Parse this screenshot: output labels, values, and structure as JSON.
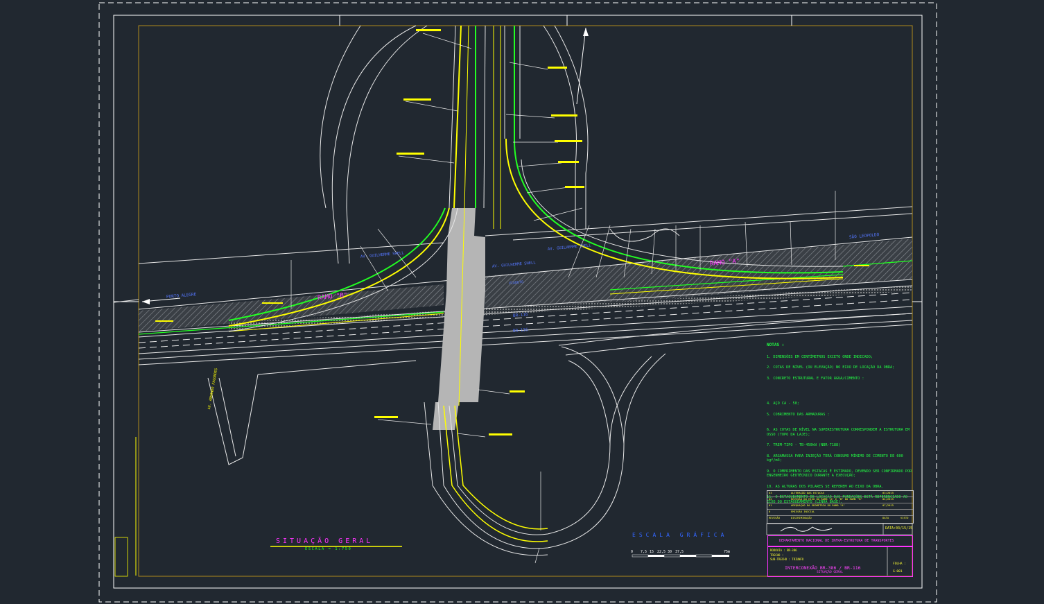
{
  "drawing": {
    "title_main": "SITUAÇÃO  GERAL",
    "title_scale": "ESCALA = 1:750",
    "graphic_scale_title": "ESCALA GRÁFICA",
    "graphic_scale_ticks": [
      "0",
      "7,5",
      "15",
      "22,5",
      "30",
      "37,5",
      "75m"
    ]
  },
  "labels": {
    "ramo_a": "RAMO \"A\"",
    "ramo_b": "RAMO \"B\"",
    "av_guilherme_1": "AV. GUILHERME SHELL",
    "av_guilherme_2": "AV. GUILHERME SHELL",
    "br116_1": "BR-116",
    "br116_2": "BR-116",
    "viaduto": "VIADUTO",
    "to_left": "PORTO ALEGRE",
    "to_right": "SÃO LEOPOLDO",
    "av_armando": "AV. ARMANDO FAGUNDES"
  },
  "notes": {
    "heading": "NOTAS :",
    "items": [
      "1.  DIMENSÕES EM CENTÍMETROS EXCETO ONDE INDICADO;",
      "2.  COTAS DE NÍVEL (OU ELEVAÇÃO) NO EIXO DE LOCAÇÃO DA OBRA;",
      "3.  CONCRETO ESTRUTURAL E FATOR ÁGUA/CIMENTO :",
      "4.  AÇO CA - 50;",
      "5.  COBRIMENTO DAS ARMADURAS :",
      "6.  AS COTAS DE NÍVEL NA SUPERESTRUTURA CORRESPONDEM A ESTRUTURA EM OSSO (TOPO DA LAJE);",
      "7.  TREM-TIPO - TB-450kN (NBR-7188)",
      "8.  ARGAMASSA PARA INJEÇÃO TERÁ CONSUMO MÍNIMO DE CIMENTO DE 600 kgf/m3;",
      "9.  O COMPRIMENTO DAS ESTACAS É ESTIMADO, DEVENDO SER CONFIRMADO POR ENGENHEIRO GEOTÉCNICO DURANTE A EXECUÇÃO;",
      "10. AS ALTURAS DOS PILARES SE REFEREM AO EIXO DA OBRA.",
      "11. O ESTAQUEAMENTO DE LOCAÇÃO DAS FUNDAÇÕES ESTÁ REFERENCIADO AO EIXO DO ESTAQUEAMENTO (LINHA BASE)."
    ]
  },
  "revisions": {
    "header": [
      "REVISÃO",
      "DISCRIMINAÇÃO",
      "DATA",
      "VISTO"
    ],
    "rows": [
      [
        "03",
        "ALTERAÇÃO DAS ESTACAS",
        "03/2015"
      ],
      [
        "02",
        "REVISÃO DO EIXO DO RAMO \"A\" E \"B\" DO RAMO \"B\"",
        "04/2015"
      ],
      [
        "01",
        "ADEQUAÇÃO DA GEOMETRIA DO RAMO \"A\"",
        "07/2015"
      ],
      [
        "0",
        "EMISSÃO INICIAL",
        ""
      ]
    ]
  },
  "title_block": {
    "date": "DATA:03/15/15",
    "department": "DEPARTAMENTO NACIONAL DE INFRA-ESTRUTURA DE TRANSPORTES",
    "rodovia": "RODOVIA :   BR-386",
    "trecho": "TRECHO :",
    "subtrecho": "SUB-TRECHO :  TRIUNFO",
    "project": "INTERCONEXÃO BR-386 / BR-116",
    "subtitle": "SITUAÇÃO GERAL",
    "folha_label": "FOLHA :",
    "folha": "G-001"
  },
  "colors": {
    "background": "#212830",
    "lines": "#e8e8e8",
    "yellow": "#ffff00",
    "green": "#22ff22",
    "magenta": "#ff33ff",
    "blue": "#3366ff",
    "orange_frame": "#b08a1c"
  }
}
